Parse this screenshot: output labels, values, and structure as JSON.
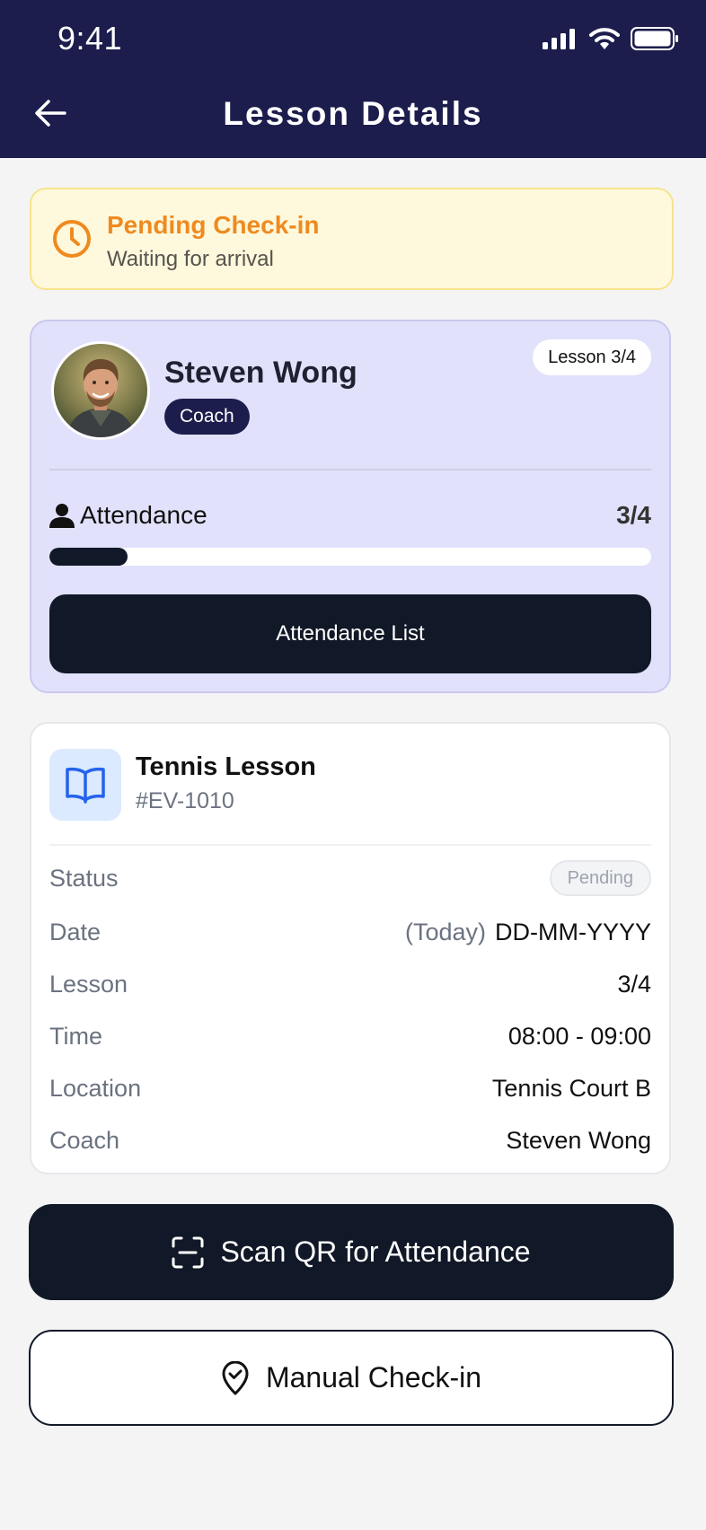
{
  "status_bar": {
    "time": "9:41"
  },
  "header": {
    "title": "Lesson Details"
  },
  "pending_banner": {
    "title": "Pending Check-in",
    "subtitle": "Waiting for arrival",
    "accent_color": "#ef8a1f"
  },
  "coach_card": {
    "name": "Steven Wong",
    "role": "Coach",
    "lesson_badge": "Lesson 3/4",
    "attendance_label": "Attendance",
    "attendance_count": "3/4",
    "attendance_progress": 0.13,
    "attendance_list_button": "Attendance List"
  },
  "lesson_card": {
    "title": "Tennis Lesson",
    "code": "#EV-1010",
    "details": {
      "status": {
        "label": "Status",
        "value": "Pending"
      },
      "date": {
        "label": "Date",
        "prefix": "(Today)",
        "value": "DD-MM-YYYY"
      },
      "lesson": {
        "label": "Lesson",
        "value": "3/4"
      },
      "time": {
        "label": "Time",
        "value": "08:00 - 09:00"
      },
      "location": {
        "label": "Location",
        "value": "Tennis Court B"
      },
      "coach": {
        "label": "Coach",
        "value": "Steven Wong"
      }
    }
  },
  "actions": {
    "scan_qr": "Scan QR for Attendance",
    "manual_checkin": "Manual Check-in"
  },
  "colors": {
    "header_bg": "#1c1d4c",
    "primary_dark": "#111827",
    "card_lavender": "#e1e1fb",
    "banner_bg": "#fef8dc",
    "lesson_icon_blue": "#2563eb"
  }
}
